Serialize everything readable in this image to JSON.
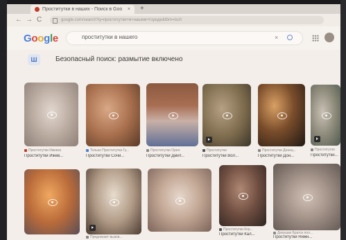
{
  "browser": {
    "tab_title": "Проститутки в наших - Поиск в Google",
    "tab_close": "×",
    "new_tab": "+",
    "back": "←",
    "forward": "→",
    "reload": "C",
    "address": "google.com/search?q=проститутки+в+нашем+городе&tbm=isch"
  },
  "search": {
    "query": "проститутки в нашего",
    "clear": "×"
  },
  "safesearch": {
    "icon_label": "Ш",
    "message": "Безопасный поиск: размытие включено"
  },
  "results": [
    {
      "source": "Проститутки Ижевск",
      "caption": "Проститутки Ижев..."
    },
    {
      "source": "Только Проститутки Гу...",
      "caption": "Проститутки Сочи..."
    },
    {
      "source": "Проститутки Орел",
      "caption": "Проститутки Дмит..."
    },
    {
      "source": "Проститутки",
      "caption": "Проститутки Вол..."
    },
    {
      "source": "Проститутки Донец...",
      "caption": "Проститутки Дон..."
    },
    {
      "source": "Проститутки",
      "caption": "Проститутки..."
    },
    {
      "source": "",
      "caption": ""
    },
    {
      "source": "Предлагает вызов...",
      "caption": ""
    },
    {
      "source": "",
      "caption": ""
    },
    {
      "source": "Проститутки Кор...",
      "caption": "Проститутки Кал..."
    },
    {
      "source": "Девушки Братск пол...",
      "caption": "Проститутки Нижн..."
    }
  ],
  "colors": {
    "google_blue": "#4a7fd9",
    "google_red": "#d9453a",
    "google_yellow": "#e2b02d",
    "google_green": "#3f9b5a"
  }
}
